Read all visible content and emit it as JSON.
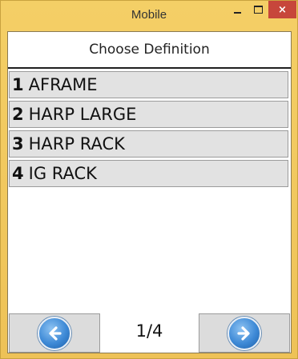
{
  "window": {
    "title": "Mobile",
    "minimize_icon": "minimize-icon",
    "maximize_icon": "maximize-icon",
    "close_icon": "close-icon",
    "close_glyph": "×"
  },
  "dialog": {
    "heading": "Choose Definition",
    "items": [
      {
        "number": "1",
        "label": "AFRAME"
      },
      {
        "number": "2",
        "label": "HARP LARGE"
      },
      {
        "number": "3",
        "label": "HARP RACK"
      },
      {
        "number": "4",
        "label": "IG RACK"
      }
    ],
    "page_indicator": "1/4",
    "prev_icon": "arrow-left-circle-icon",
    "next_icon": "arrow-right-circle-icon"
  },
  "colors": {
    "frame": "#f0c85a",
    "close_button": "#c7463b",
    "item_background": "#e2e2e2",
    "arrow_blue": "#3d89d6"
  }
}
